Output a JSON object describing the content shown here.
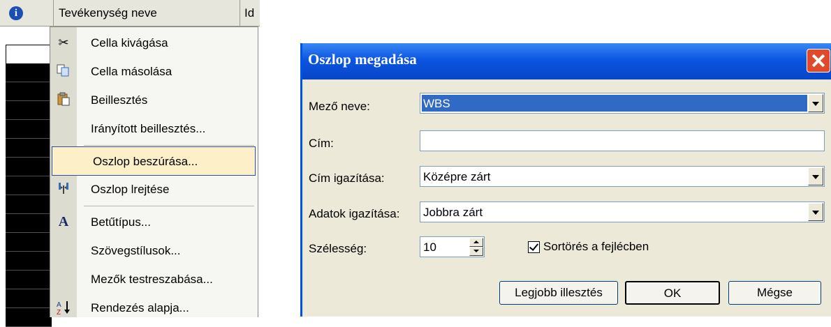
{
  "sheet": {
    "header_name": "Tevékenység neve",
    "header_partial": "Id"
  },
  "context_menu": {
    "items": [
      {
        "label": "Cella kivágása",
        "icon": "scissors-icon"
      },
      {
        "label": "Cella másolása",
        "icon": "copy-icon"
      },
      {
        "label": "Beillesztés",
        "icon": "paste-icon"
      },
      {
        "label": "Irányított beillesztés..."
      },
      {
        "label": "Oszlop beszúrása...",
        "highlighted": true
      },
      {
        "label": "Oszlop lrejtése",
        "icon": "hide-column-icon"
      },
      {
        "label": "Betűtípus...",
        "icon": "font-icon"
      },
      {
        "label": "Szövegstílusok..."
      },
      {
        "label": "Mezők testreszabása..."
      },
      {
        "label": "Rendezés alapja...",
        "icon": "sort-az-icon"
      }
    ]
  },
  "dialog": {
    "title": "Oszlop megadása",
    "field_name_label": "Mező neve:",
    "field_name_value": "WBS",
    "title_label": "Cím:",
    "title_value": "",
    "title_align_label": "Cím igazítása:",
    "title_align_value": "Középre zárt",
    "data_align_label": "Adatok igazítása:",
    "data_align_value": "Jobbra zárt",
    "width_label": "Szélesség:",
    "width_value": "10",
    "wrap_label": "Sortörés a fejlécben",
    "wrap_checked": true,
    "best_fit_label": "Legjobb illesztés",
    "ok_label": "OK",
    "cancel_label": "Mégse"
  },
  "colors": {
    "titlebar": "#0b55e0",
    "selection": "#316ac5",
    "menu_highlight": "#fdf0c8"
  }
}
